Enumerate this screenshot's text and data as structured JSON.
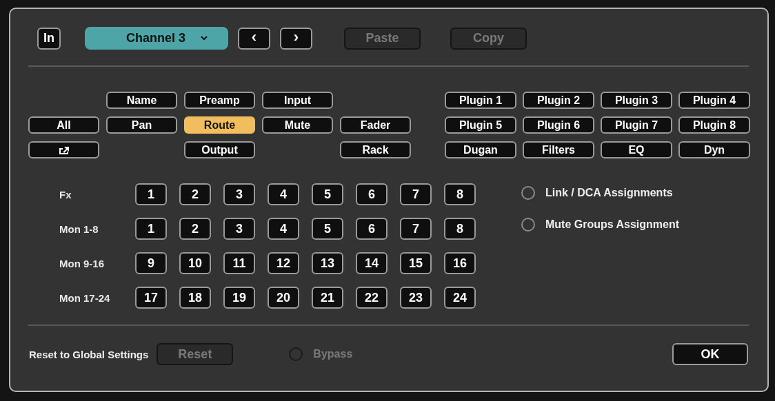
{
  "toolbar": {
    "in_button": "In",
    "channel": {
      "value": "Channel 3"
    },
    "prev": "‹",
    "next": "›",
    "paste": {
      "label": "Paste",
      "disabled": true
    },
    "copy": {
      "label": "Copy",
      "disabled": true
    }
  },
  "filters": [
    {
      "kind": "text",
      "label": "Name",
      "selected": false
    },
    {
      "kind": "text",
      "label": "Preamp",
      "selected": false
    },
    {
      "kind": "text",
      "label": "Input",
      "selected": false
    },
    {
      "kind": "text",
      "label": "All",
      "selected": false
    },
    {
      "kind": "text",
      "label": "Pan",
      "selected": false
    },
    {
      "kind": "text",
      "label": "Route",
      "selected": true
    },
    {
      "kind": "text",
      "label": "Mute",
      "selected": false
    },
    {
      "kind": "text",
      "label": "Fader",
      "selected": false
    },
    {
      "kind": "icon",
      "selected": false
    },
    {
      "kind": "text",
      "label": "Output",
      "selected": false
    },
    {
      "kind": "text",
      "label": "Rack",
      "selected": false
    }
  ],
  "plugins": [
    {
      "label": "Plugin 1",
      "selected": false
    },
    {
      "label": "Plugin 2",
      "selected": false
    },
    {
      "label": "Plugin 3",
      "selected": false
    },
    {
      "label": "Plugin 4",
      "selected": false
    },
    {
      "label": "Plugin 5",
      "selected": false
    },
    {
      "label": "Plugin 6",
      "selected": false
    },
    {
      "label": "Plugin 7",
      "selected": false
    },
    {
      "label": "Plugin 8",
      "selected": false
    },
    {
      "label": "Dugan",
      "selected": false
    },
    {
      "label": "Filters",
      "selected": false
    },
    {
      "label": "EQ",
      "selected": false
    },
    {
      "label": "Dyn",
      "selected": false
    }
  ],
  "sends": [
    {
      "label": "Fx",
      "buttons": [
        {
          "label": "1",
          "selected": false
        },
        {
          "label": "2",
          "selected": false
        },
        {
          "label": "3",
          "selected": false
        },
        {
          "label": "4",
          "selected": false
        },
        {
          "label": "5",
          "selected": false
        },
        {
          "label": "6",
          "selected": false
        },
        {
          "label": "7",
          "selected": false
        },
        {
          "label": "8",
          "selected": false
        }
      ]
    },
    {
      "label": "Mon 1-8",
      "buttons": [
        {
          "label": "1",
          "selected": false
        },
        {
          "label": "2",
          "selected": false
        },
        {
          "label": "3",
          "selected": false
        },
        {
          "label": "4",
          "selected": false
        },
        {
          "label": "5",
          "selected": false
        },
        {
          "label": "6",
          "selected": false
        },
        {
          "label": "7",
          "selected": false
        },
        {
          "label": "8",
          "selected": false
        }
      ]
    },
    {
      "label": "Mon 9-16",
      "buttons": [
        {
          "label": "9",
          "selected": false
        },
        {
          "label": "10",
          "selected": false
        },
        {
          "label": "11",
          "selected": false
        },
        {
          "label": "12",
          "selected": false
        },
        {
          "label": "13",
          "selected": false
        },
        {
          "label": "14",
          "selected": false
        },
        {
          "label": "15",
          "selected": false
        },
        {
          "label": "16",
          "selected": false
        }
      ]
    },
    {
      "label": "Mon 17-24",
      "buttons": [
        {
          "label": "17",
          "selected": false
        },
        {
          "label": "18",
          "selected": false
        },
        {
          "label": "19",
          "selected": false
        },
        {
          "label": "20",
          "selected": false
        },
        {
          "label": "21",
          "selected": false
        },
        {
          "label": "22",
          "selected": false
        },
        {
          "label": "23",
          "selected": false
        },
        {
          "label": "24",
          "selected": false
        }
      ]
    }
  ],
  "assignments": [
    {
      "label": "Link / DCA Assignments",
      "selected": false
    },
    {
      "label": "Mute Groups Assignment",
      "selected": false
    }
  ],
  "footer": {
    "reset_label": "Reset to Global Settings",
    "reset": {
      "label": "Reset",
      "disabled": true
    },
    "bypass": {
      "label": "Bypass",
      "selected": false,
      "disabled": true
    },
    "ok": "OK"
  }
}
